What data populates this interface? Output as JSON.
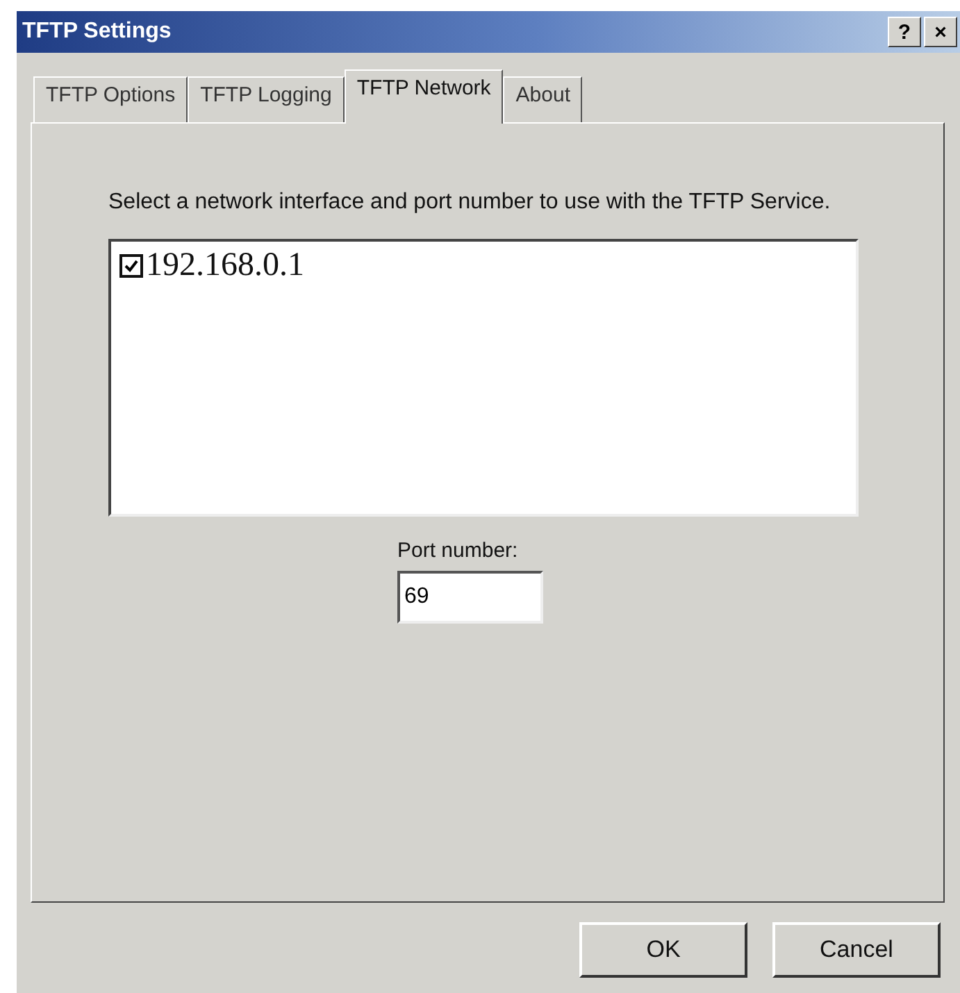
{
  "window": {
    "title": "TFTP Settings",
    "title_buttons": [
      "?",
      "×"
    ]
  },
  "tabs": [
    {
      "label": "TFTP Options",
      "selected": false
    },
    {
      "label": "TFTP Logging",
      "selected": false
    },
    {
      "label": "TFTP Network",
      "selected": true
    },
    {
      "label": "About",
      "selected": false
    }
  ],
  "instructions": "Select a network interface and port number to use with the TFTP Service.",
  "interfaces": [
    {
      "label": "192.168.0.1",
      "checked": true
    }
  ],
  "port": {
    "label": "Port number:",
    "value": "69"
  },
  "buttons": [
    "OK",
    "Cancel"
  ]
}
